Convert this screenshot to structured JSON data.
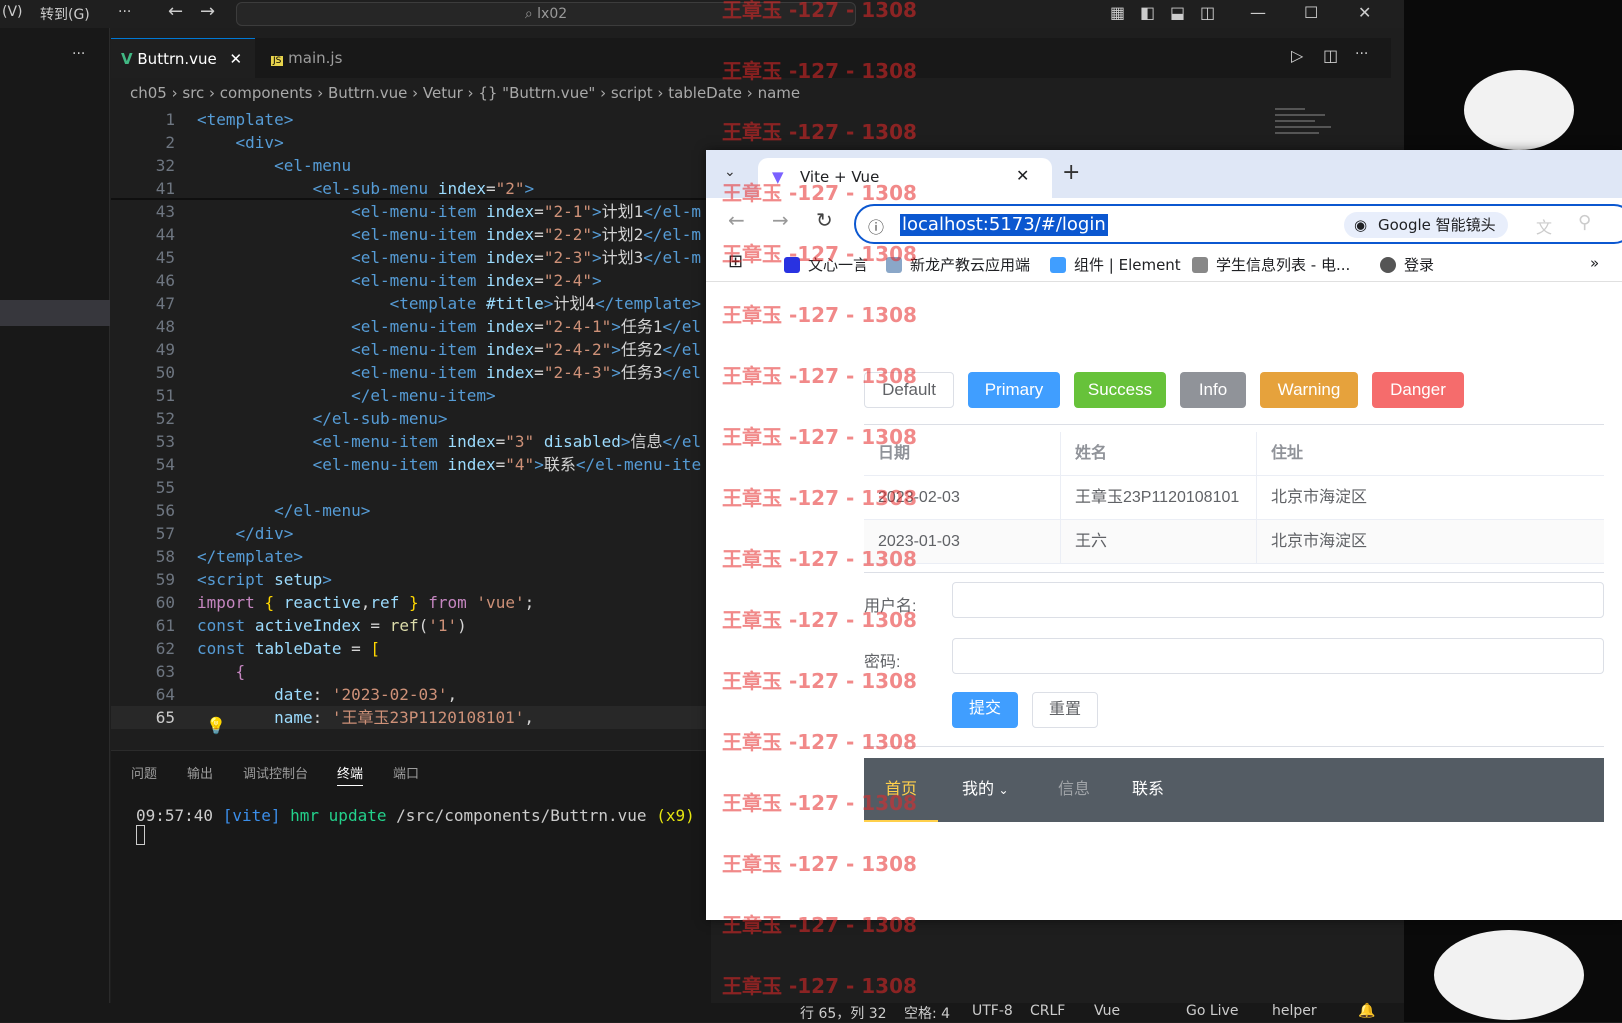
{
  "vscode": {
    "menu_view": "(V)",
    "menu_goto": "转到(G)",
    "more": "···",
    "search": "lx02",
    "tabs": [
      {
        "label": "Buttrn.vue"
      },
      {
        "label": "main.js"
      }
    ],
    "breadcrumb": "ch05 › src › components › Buttrn.vue › Vetur › {} \"Buttrn.vue\" › script › tableDate › name",
    "lines": [
      {
        "n": "1",
        "html": "<span class='tag'>&lt;template&gt;</span>"
      },
      {
        "n": "2",
        "html": "    <span class='tag'>&lt;div&gt;</span>"
      },
      {
        "n": "32",
        "html": "        <span class='tag'>&lt;el-menu</span>"
      },
      {
        "n": "41",
        "html": "            <span class='tag'>&lt;el-sub-menu</span> <span class='attr'>index</span>=<span class='str'>\"2\"</span><span class='tag'>&gt;</span>"
      },
      {
        "n": "43",
        "html": "                <span class='tag'>&lt;el-menu-item</span> <span class='attr'>index</span>=<span class='str'>\"2-1\"</span><span class='tag'>&gt;</span>计划1<span class='tag'>&lt;/el-m</span>"
      },
      {
        "n": "44",
        "html": "                <span class='tag'>&lt;el-menu-item</span> <span class='attr'>index</span>=<span class='str'>\"2-2\"</span><span class='tag'>&gt;</span>计划2<span class='tag'>&lt;/el-m</span>"
      },
      {
        "n": "45",
        "html": "                <span class='tag'>&lt;el-menu-item</span> <span class='attr'>index</span>=<span class='str'>\"2-3\"</span><span class='tag'>&gt;</span>计划3<span class='tag'>&lt;/el-m</span>"
      },
      {
        "n": "46",
        "html": "                <span class='tag'>&lt;el-menu-item</span> <span class='attr'>index</span>=<span class='str'>\"2-4\"</span><span class='tag'>&gt;</span>"
      },
      {
        "n": "47",
        "html": "                    <span class='tag'>&lt;template</span> <span class='attr'>#title</span><span class='tag'>&gt;</span>计划4<span class='tag'>&lt;/template&gt;</span>"
      },
      {
        "n": "48",
        "html": "                <span class='tag'>&lt;el-menu-item</span> <span class='attr'>index</span>=<span class='str'>\"2-4-1\"</span><span class='tag'>&gt;</span>任务1<span class='tag'>&lt;/el</span>"
      },
      {
        "n": "49",
        "html": "                <span class='tag'>&lt;el-menu-item</span> <span class='attr'>index</span>=<span class='str'>\"2-4-2\"</span><span class='tag'>&gt;</span>任务2<span class='tag'>&lt;/el</span>"
      },
      {
        "n": "50",
        "html": "                <span class='tag'>&lt;el-menu-item</span> <span class='attr'>index</span>=<span class='str'>\"2-4-3\"</span><span class='tag'>&gt;</span>任务3<span class='tag'>&lt;/el</span>"
      },
      {
        "n": "51",
        "html": "                <span class='tag'>&lt;/el-menu-item&gt;</span>"
      },
      {
        "n": "52",
        "html": "            <span class='tag'>&lt;/el-sub-menu&gt;</span>"
      },
      {
        "n": "53",
        "html": "            <span class='tag'>&lt;el-menu-item</span> <span class='attr'>index</span>=<span class='str'>\"3\"</span> <span class='attr'>disabled</span><span class='tag'>&gt;</span>信息<span class='tag'>&lt;/el</span>"
      },
      {
        "n": "54",
        "html": "            <span class='tag'>&lt;el-menu-item</span> <span class='attr'>index</span>=<span class='str'>\"4\"</span><span class='tag'>&gt;</span>联系<span class='tag'>&lt;/el-menu-ite</span>"
      },
      {
        "n": "55",
        "html": ""
      },
      {
        "n": "56",
        "html": "        <span class='tag'>&lt;/el-menu&gt;</span>"
      },
      {
        "n": "57",
        "html": "    <span class='tag'>&lt;/div&gt;</span>"
      },
      {
        "n": "58",
        "html": "<span class='tag'>&lt;/template&gt;</span>"
      },
      {
        "n": "59",
        "html": "<span class='tag'>&lt;script</span> <span class='attr'>setup</span><span class='tag'>&gt;</span>"
      },
      {
        "n": "60",
        "html": "<span class='kw'>import</span> <span class='pun'>{</span> <span class='var'>reactive</span>,<span class='var'>ref</span> <span class='pun'>}</span> <span class='kw'>from</span> <span class='str'>'vue'</span>;"
      },
      {
        "n": "61",
        "html": "<span class='key'>const</span> <span class='var'>activeIndex</span> = <span class='fn'>ref</span>(<span class='str'>'1'</span>)"
      },
      {
        "n": "62",
        "html": "<span class='key'>const</span> <span class='var'>tableDate</span> = <span class='pun'>[</span>"
      },
      {
        "n": "63",
        "html": "    <span class='kw'>{</span>"
      },
      {
        "n": "64",
        "html": "        <span class='var'>date</span>: <span class='str'>'2023-02-03'</span>,"
      },
      {
        "n": "65",
        "html": "        <span class='var'>name</span>: <span class='str'>'王章玉23P1120108101'</span>,"
      }
    ],
    "panel_tabs": [
      "问题",
      "输出",
      "调试控制台",
      "终端",
      "端口"
    ],
    "terminal_time": "09:57:40",
    "terminal_tag": "[vite]",
    "terminal_hmr": "hmr update",
    "terminal_path": "/src/components/Buttrn.vue",
    "terminal_count": "(x9)",
    "status": {
      "pos": "行 65，列 32",
      "spaces": "空格: 4",
      "enc": "UTF-8",
      "eol": "CRLF",
      "lang": "Vue",
      "golive": "Go Live",
      "helper": "helper"
    }
  },
  "browser": {
    "tab_title": "Vite + Vue",
    "url": "localhost:5173/#/login",
    "lens": "Google 智能镜头",
    "bookmarks": [
      "文心一言",
      "新龙产教云应用端",
      "组件 | Element",
      "学生信息列表 - 电...",
      "登录"
    ],
    "buttons": [
      {
        "label": "Default"
      },
      {
        "label": "Primary"
      },
      {
        "label": "Success"
      },
      {
        "label": "Info"
      },
      {
        "label": "Warning"
      },
      {
        "label": "Danger"
      }
    ],
    "table": {
      "headers": [
        "日期",
        "姓名",
        "住址"
      ],
      "rows": [
        [
          "2023-02-03",
          "王章玉23P1120108101",
          "北京市海淀区"
        ],
        [
          "2023-01-03",
          "王六",
          "北京市海淀区"
        ]
      ]
    },
    "form": {
      "username_label": "用户名:",
      "password_label": "密码:",
      "submit": "提交",
      "reset": "重置"
    },
    "menu": [
      "首页",
      "我的",
      "信息",
      "联系"
    ]
  },
  "watermark": "王章玉 -127 - 1308",
  "colors": {
    "primary": "#409eff",
    "success": "#67c23a",
    "info": "#909399",
    "warning": "#e6a23c",
    "danger": "#f56c6c",
    "menu_bg": "#545c64",
    "menu_active": "#ffd04b"
  }
}
